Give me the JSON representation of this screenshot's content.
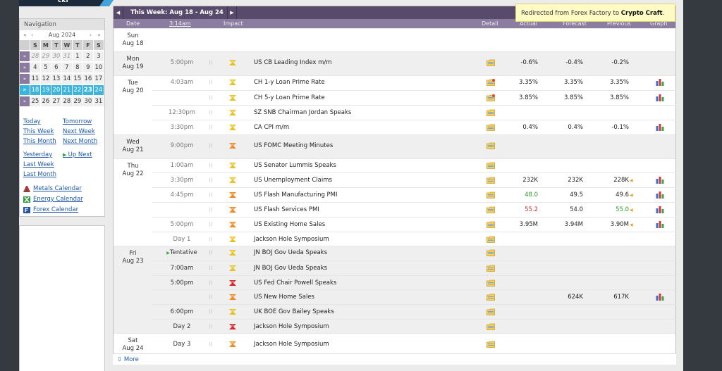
{
  "logo": {
    "text": "ckf"
  },
  "sidebar": {
    "navigation_label": "Navigation",
    "prev_year": "«",
    "prev_month": "‹",
    "month": "Aug 2024",
    "next_month": "›",
    "next_year": "»",
    "weekday_headers": [
      "S",
      "M",
      "T",
      "W",
      "T",
      "F",
      "S"
    ],
    "weeks": [
      {
        "arrow": "»",
        "days": [
          "28",
          "29",
          "30",
          "31",
          "1",
          "2",
          "3"
        ],
        "out": [
          0,
          1,
          2,
          3
        ]
      },
      {
        "arrow": "»",
        "days": [
          "4",
          "5",
          "6",
          "7",
          "8",
          "9",
          "10"
        ],
        "out": []
      },
      {
        "arrow": "»",
        "days": [
          "11",
          "12",
          "13",
          "14",
          "15",
          "16",
          "17"
        ],
        "out": []
      },
      {
        "arrow": "»",
        "days": [
          "18",
          "19",
          "20",
          "21",
          "22",
          "23",
          "24"
        ],
        "out": []
      },
      {
        "arrow": "»",
        "days": [
          "25",
          "26",
          "27",
          "28",
          "29",
          "30",
          "31"
        ],
        "out": []
      }
    ],
    "links_left": [
      "Today",
      "This Week",
      "This Month"
    ],
    "links_right": [
      "Tomorrow",
      "Next Week",
      "Next Month"
    ],
    "links2_left": [
      "Yesterday",
      "Last Week",
      "Last Month"
    ],
    "up_next": "Up Next",
    "calendars": [
      "Metals Calendar",
      "Energy Calendar",
      "Forex Calendar"
    ]
  },
  "toolbar": {
    "prev": "◀",
    "week_title": "This Week: Aug 18 - Aug 24",
    "next": "▶"
  },
  "columns": {
    "date": "Date",
    "time": "3:14am",
    "impact": "Impact",
    "detail": "Detail",
    "actual": "Actual",
    "forecast": "Forecast",
    "previous": "Previous",
    "graph": "Graph"
  },
  "tooltip": {
    "prefix": "Redirected from Forex Factory to ",
    "brand": "Crypto Craft",
    "suffix": "."
  },
  "days": [
    {
      "day": "Sun",
      "date": "Aug 18"
    },
    {
      "day": "Mon",
      "date": "Aug 19"
    },
    {
      "day": "Tue",
      "date": "Aug 20"
    },
    {
      "day": "Wed",
      "date": "Aug 21"
    },
    {
      "day": "Thu",
      "date": "Aug 22"
    },
    {
      "day": "Fri",
      "date": "Aug 23"
    },
    {
      "day": "Sat",
      "date": "Aug 24"
    }
  ],
  "events": [
    {
      "time": "5:00pm",
      "impact": "yellow",
      "title": "US CB Leading Index m/m",
      "detail": "folder",
      "actual": "-0.6%",
      "forecast": "-0.4%",
      "previous": "-0.2%",
      "graph": false
    },
    {
      "time": "4:03am",
      "impact": "yellow",
      "title": "CH 1-y Loan Prime Rate",
      "detail": "folder-star",
      "actual": "3.35%",
      "forecast": "3.35%",
      "previous": "3.35%",
      "graph": true
    },
    {
      "time": "",
      "impact": "yellow",
      "title": "CH 5-y Loan Prime Rate",
      "detail": "folder-star",
      "actual": "3.85%",
      "forecast": "3.85%",
      "previous": "3.85%",
      "graph": true
    },
    {
      "time": "12:30pm",
      "impact": "yellow",
      "title": "SZ SNB Chairman Jordan Speaks",
      "detail": "folder",
      "actual": "",
      "forecast": "",
      "previous": "",
      "graph": false
    },
    {
      "time": "3:30pm",
      "impact": "yellow",
      "title": "CA CPI m/m",
      "detail": "folder",
      "actual": "0.4%",
      "forecast": "0.4%",
      "previous": "-0.1%",
      "graph": true
    },
    {
      "time": "9:00pm",
      "impact": "orange",
      "title": "US FOMC Meeting Minutes",
      "detail": "folder",
      "actual": "",
      "forecast": "",
      "previous": "",
      "graph": false
    },
    {
      "time": "1:00am",
      "impact": "yellow",
      "title": "US Senator Lummis Speaks",
      "detail": "folder",
      "actual": "",
      "forecast": "",
      "previous": "",
      "graph": false
    },
    {
      "time": "3:30pm",
      "impact": "yellow",
      "title": "US Unemployment Claims",
      "detail": "folder",
      "actual": "232K",
      "forecast": "232K",
      "previous": "228K",
      "graph": true
    },
    {
      "time": "4:45pm",
      "impact": "orange",
      "title": "US Flash Manufacturing PMI",
      "detail": "folder",
      "actual": "48.0",
      "forecast": "49.5",
      "previous": "49.6",
      "graph": true
    },
    {
      "time": "",
      "impact": "orange",
      "title": "US Flash Services PMI",
      "detail": "folder",
      "actual": "55.2",
      "forecast": "54.0",
      "previous": "55.0",
      "graph": true
    },
    {
      "time": "5:00pm",
      "impact": "orange",
      "title": "US Existing Home Sales",
      "detail": "folder",
      "actual": "3.95M",
      "forecast": "3.94M",
      "previous": "3.90M",
      "graph": true
    },
    {
      "time": "Day 1",
      "impact": "yellow",
      "title": "Jackson Hole Symposium",
      "detail": "folder",
      "actual": "",
      "forecast": "",
      "previous": "",
      "graph": false
    },
    {
      "time": "Tentative",
      "impact": "yellow",
      "title": "JN BOJ Gov Ueda Speaks",
      "detail": "folder",
      "actual": "",
      "forecast": "",
      "previous": "",
      "graph": false
    },
    {
      "time": "7:00am",
      "impact": "yellow",
      "title": "JN BOJ Gov Ueda Speaks",
      "detail": "folder",
      "actual": "",
      "forecast": "",
      "previous": "",
      "graph": false
    },
    {
      "time": "5:00pm",
      "impact": "red",
      "title": "US Fed Chair Powell Speaks",
      "detail": "folder",
      "actual": "",
      "forecast": "",
      "previous": "",
      "graph": false
    },
    {
      "time": "",
      "impact": "orange",
      "title": "US New Home Sales",
      "detail": "folder",
      "actual": "",
      "forecast": "624K",
      "previous": "617K",
      "graph": true
    },
    {
      "time": "6:00pm",
      "impact": "yellow",
      "title": "UK BOE Gov Bailey Speaks",
      "detail": "folder",
      "actual": "",
      "forecast": "",
      "previous": "",
      "graph": false
    },
    {
      "time": "Day 2",
      "impact": "red",
      "title": "Jackson Hole Symposium",
      "detail": "folder",
      "actual": "",
      "forecast": "",
      "previous": "",
      "graph": false
    },
    {
      "time": "Day 3",
      "impact": "orange",
      "title": "Jackson Hole Symposium",
      "detail": "folder",
      "actual": "",
      "forecast": "",
      "previous": "",
      "graph": false
    }
  ],
  "more": "More",
  "colors": {
    "accent": "#3cb5dd",
    "toolbar": "#574a6b",
    "link": "#1e58a6",
    "actual_better": "#2c9c2c",
    "actual_worse": "#cc2f2f"
  }
}
